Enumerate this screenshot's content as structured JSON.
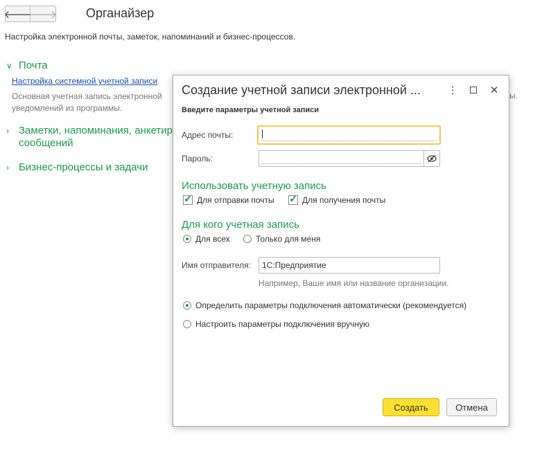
{
  "nav": {
    "back_icon": "arrow-left-icon",
    "forward_icon": "arrow-right-icon"
  },
  "page": {
    "title": "Органайзер",
    "description": "Настройка электронной почты, заметок, напоминаний и бизнес-процессов."
  },
  "sections": {
    "mail": {
      "title": "Почта",
      "link": "Настройка системной учетной записи",
      "desc": "Основная учетная запись электронной уведомлений из программы.",
      "desc_tail": "ы."
    },
    "notes": {
      "title": "Заметки, напоминания, анкетир сообщений"
    },
    "biz": {
      "title": "Бизнес-процессы и задачи"
    }
  },
  "dialog": {
    "title": "Создание учетной записи электронной ...",
    "subtitle": "Введите параметры учетной записи",
    "email_label": "Адрес почты:",
    "email_value": "",
    "password_label": "Пароль:",
    "password_value": "",
    "use_heading": "Использовать учетную запись",
    "use_send": "Для отправки почты",
    "use_receive": "Для получения почты",
    "who_heading": "Для кого учетная запись",
    "who_all": "Для всех",
    "who_me": "Только для меня",
    "sender_label": "Имя отправителя:",
    "sender_value": "1С:Предприятие",
    "sender_hint": "Например, Ваше имя или название организации.",
    "conn_auto": "Определить параметры подключения автоматически (рекомендуется)",
    "conn_manual": "Настроить параметры подключения вручную",
    "create_button": "Создать",
    "cancel_button": "Отмена"
  },
  "colors": {
    "accent_green": "#1a9b4a",
    "link_blue": "#1c4fa8",
    "primary_yellow": "#fbe034",
    "focus_yellow": "#f2c94c"
  }
}
